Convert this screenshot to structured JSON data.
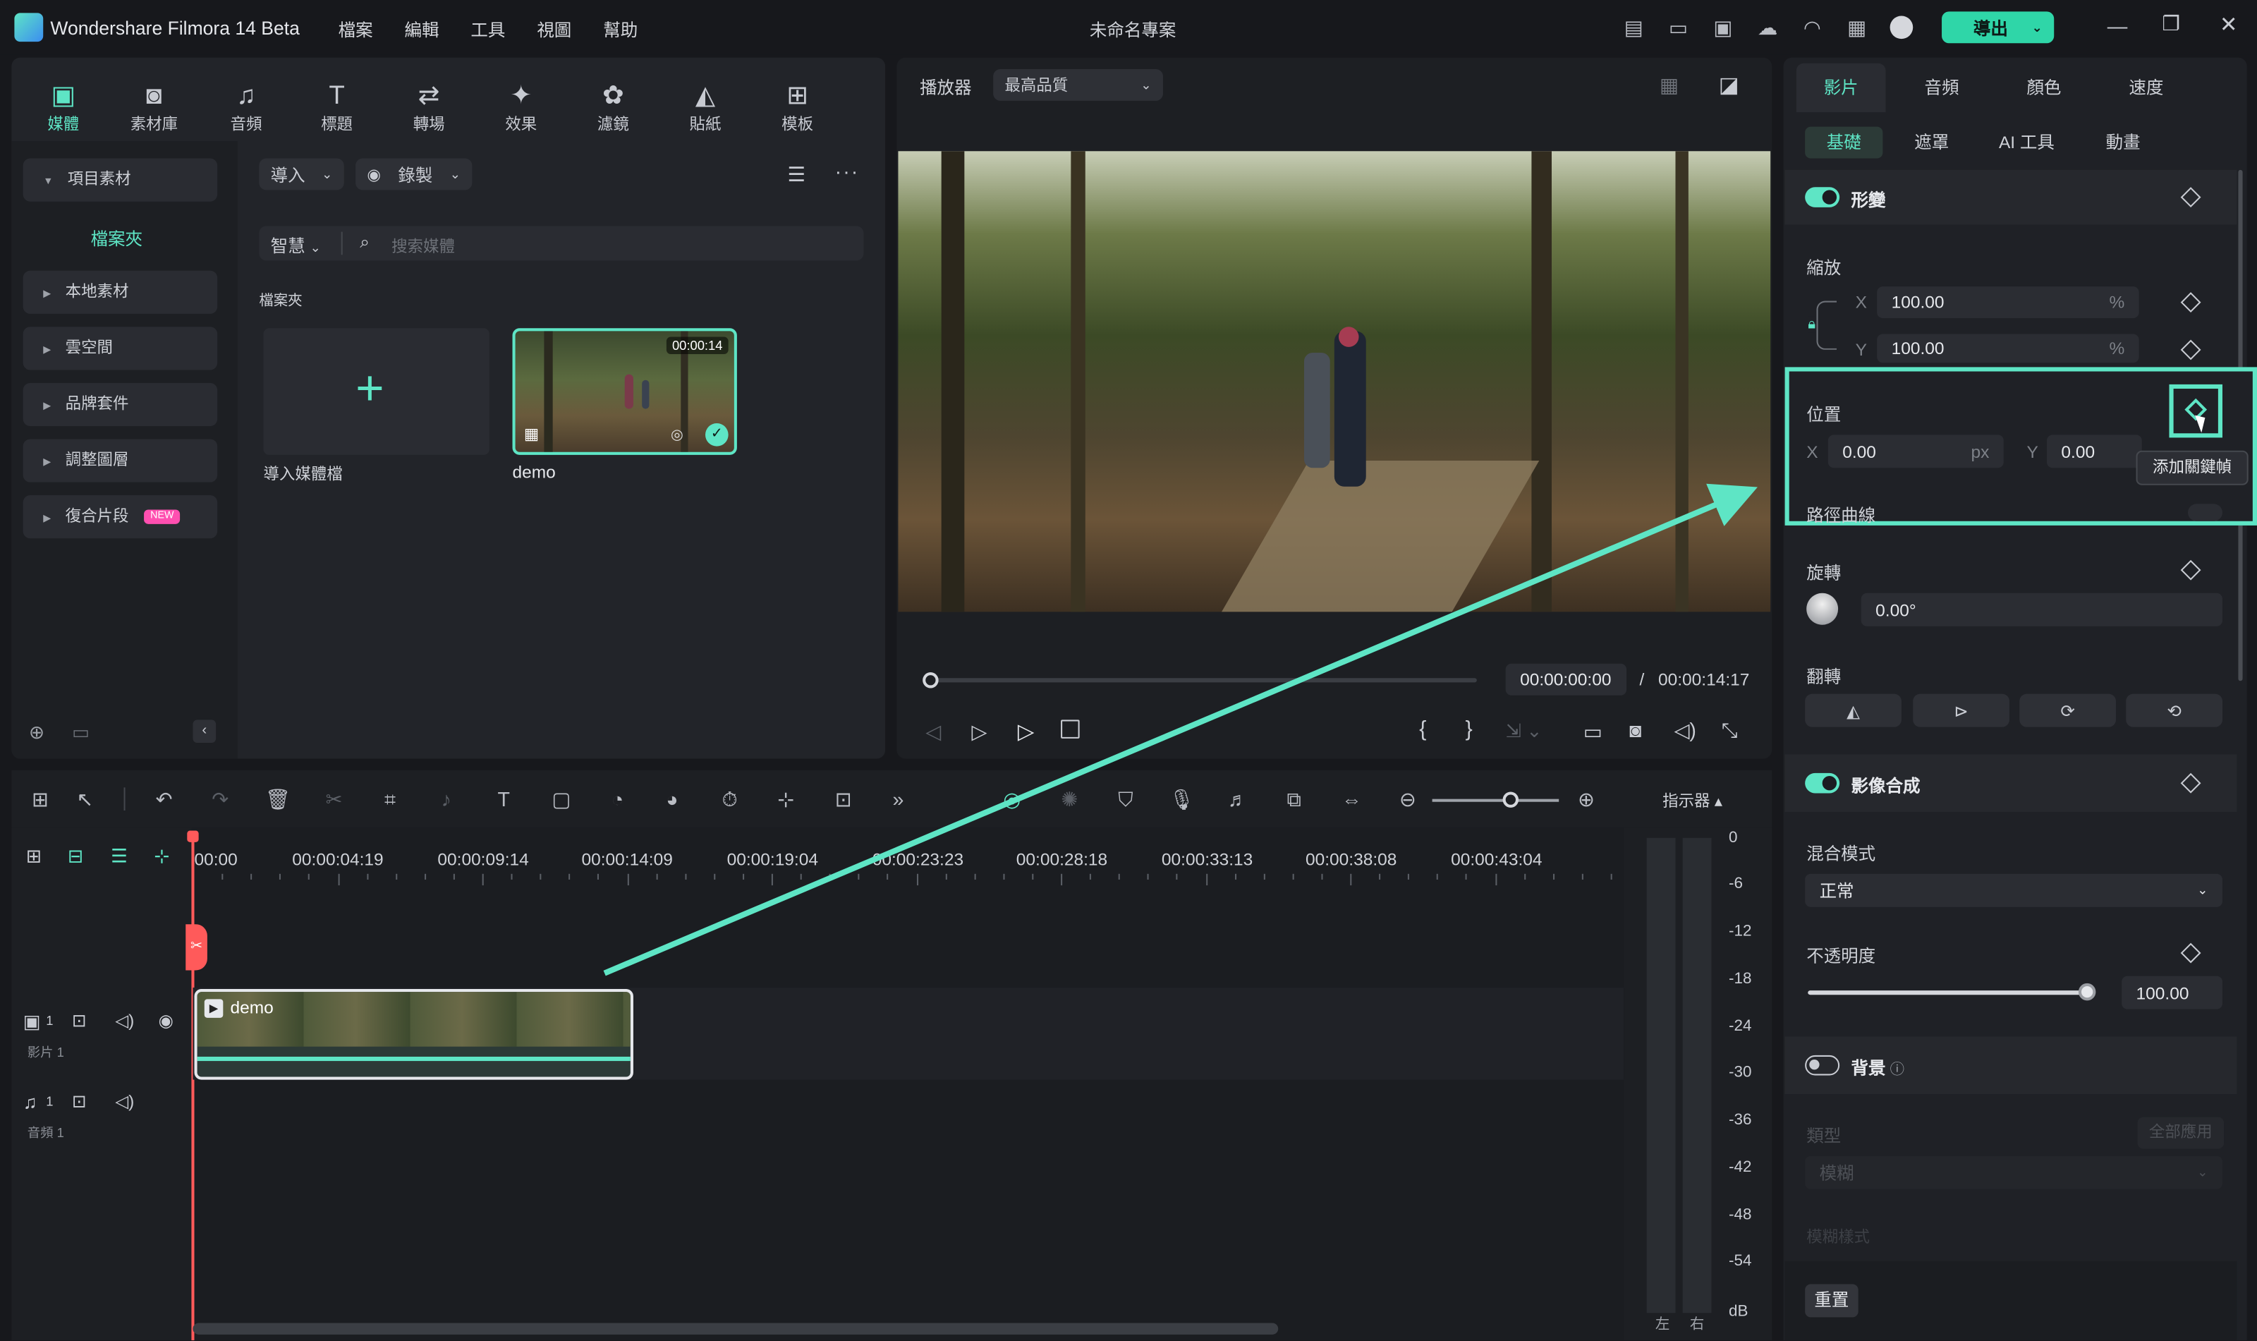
{
  "app": {
    "title": "Wondershare Filmora 14 Beta",
    "project": "未命名專案",
    "export_label": "導出"
  },
  "menu": [
    "檔案",
    "編輯",
    "工具",
    "視圖",
    "幫助"
  ],
  "toolbar_tabs": [
    {
      "label": "媒體",
      "icon": "media-icon"
    },
    {
      "label": "素材庫",
      "icon": "library-icon"
    },
    {
      "label": "音頻",
      "icon": "audio-icon"
    },
    {
      "label": "標題",
      "icon": "title-icon"
    },
    {
      "label": "轉場",
      "icon": "transition-icon"
    },
    {
      "label": "效果",
      "icon": "effects-icon"
    },
    {
      "label": "濾鏡",
      "icon": "filters-icon"
    },
    {
      "label": "貼紙",
      "icon": "stickers-icon"
    },
    {
      "label": "模板",
      "icon": "templates-icon"
    }
  ],
  "sidebar": {
    "project_media": "項目素材",
    "folder": "檔案夾",
    "items": [
      "本地素材",
      "雲空間",
      "品牌套件",
      "調整圖層",
      "復合片段"
    ],
    "new_badge": "NEW"
  },
  "media": {
    "import_label": "導入",
    "record_label": "錄製",
    "smart_label": "智慧",
    "search_placeholder": "搜索媒體",
    "folder_header": "檔案夾",
    "import_tile_label": "導入媒體檔",
    "clip_name": "demo",
    "clip_duration": "00:00:14"
  },
  "player": {
    "label": "播放器",
    "quality": "最高品質",
    "current_time": "00:00:00:00",
    "total_time": "00:00:14:17",
    "separator": "/",
    "brace_open": "{",
    "brace_close": "}"
  },
  "inspector": {
    "tabs": [
      "影片",
      "音頻",
      "顏色",
      "速度"
    ],
    "subtabs": [
      "基礎",
      "遮罩",
      "AI 工具",
      "動畫"
    ],
    "transform": "形變",
    "scale": "縮放",
    "scale_x": "100.00",
    "scale_y": "100.00",
    "percent": "%",
    "axis_x": "X",
    "axis_y": "Y",
    "position": "位置",
    "pos_x": "0.00",
    "pos_y": "0.00",
    "px": "px",
    "tooltip": "添加關鍵幀",
    "path_curve": "路徑曲線",
    "rotate": "旋轉",
    "rotate_value": "0.00°",
    "flip": "翻轉",
    "compositing": "影像合成",
    "blend_mode": "混合模式",
    "blend_value": "正常",
    "opacity": "不透明度",
    "opacity_value": "100.00",
    "opacity_level": 1.0,
    "background": "背景",
    "bg_type": "類型",
    "apply_all": "全部應用",
    "bg_value": "模糊",
    "blur_style": "模糊樣式",
    "reset": "重置"
  },
  "timeline": {
    "meter_label": "指示器",
    "ruler": [
      "00:00",
      "00:00:04:19",
      "00:00:09:14",
      "00:00:14:09",
      "00:00:19:04",
      "00:00:23:23",
      "00:00:28:18",
      "00:00:33:13",
      "00:00:38:08",
      "00:00:43:04"
    ],
    "video_track": "影片 1",
    "audio_track": "音頻 1",
    "track_num": "1",
    "clip_label": "demo",
    "db_scale": [
      "0",
      "-6",
      "-12",
      "-18",
      "-24",
      "-30",
      "-36",
      "-42",
      "-48",
      "-54",
      "dB"
    ],
    "left": "左",
    "right": "右"
  },
  "colors": {
    "accent": "#5ee5c5",
    "bg": "#17181c",
    "panel": "#222429",
    "export": "#2fd6a8"
  }
}
